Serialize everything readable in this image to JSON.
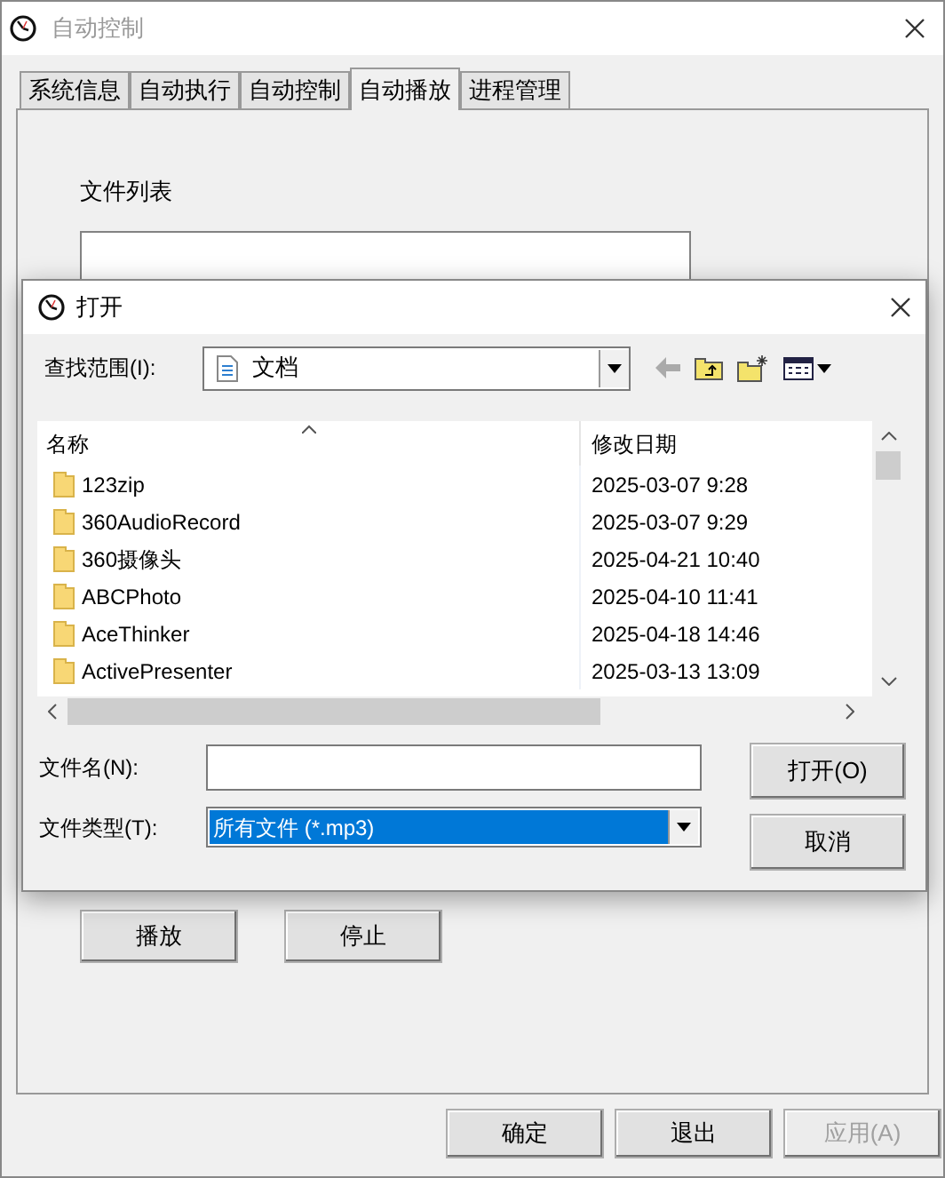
{
  "window": {
    "title": "自动控制"
  },
  "tabs": [
    {
      "label": "系统信息",
      "selected": false
    },
    {
      "label": "自动执行",
      "selected": false
    },
    {
      "label": "自动控制",
      "selected": false
    },
    {
      "label": "自动播放",
      "selected": true
    },
    {
      "label": "进程管理",
      "selected": false
    }
  ],
  "file_list": {
    "label": "文件列表"
  },
  "panel_buttons": [
    {
      "label": "播放"
    },
    {
      "label": "停止"
    }
  ],
  "footer_buttons": [
    {
      "label": "确定",
      "disabled": false
    },
    {
      "label": "退出",
      "disabled": false
    },
    {
      "label": "应用(A)",
      "disabled": true
    }
  ],
  "dialog": {
    "title": "打开",
    "look_in_label": "查找范围(I):",
    "look_in_value": "文档",
    "columns": [
      {
        "label": "名称"
      },
      {
        "label": "修改日期"
      }
    ],
    "rows": [
      {
        "name": "123zip",
        "date": "2025-03-07 9:28"
      },
      {
        "name": "360AudioRecord",
        "date": "2025-03-07 9:29"
      },
      {
        "name": "360摄像头",
        "date": "2025-04-21 10:40"
      },
      {
        "name": "ABCPhoto",
        "date": "2025-04-10 11:41"
      },
      {
        "name": "AceThinker",
        "date": "2025-04-18 14:46"
      },
      {
        "name": "ActivePresenter",
        "date": "2025-03-13 13:09"
      }
    ],
    "filename_label": "文件名(N):",
    "filetype_label": "文件类型(T):",
    "filetype_value": "所有文件 (*.mp3)",
    "open_button": "打开(O)",
    "cancel_button": "取消"
  }
}
